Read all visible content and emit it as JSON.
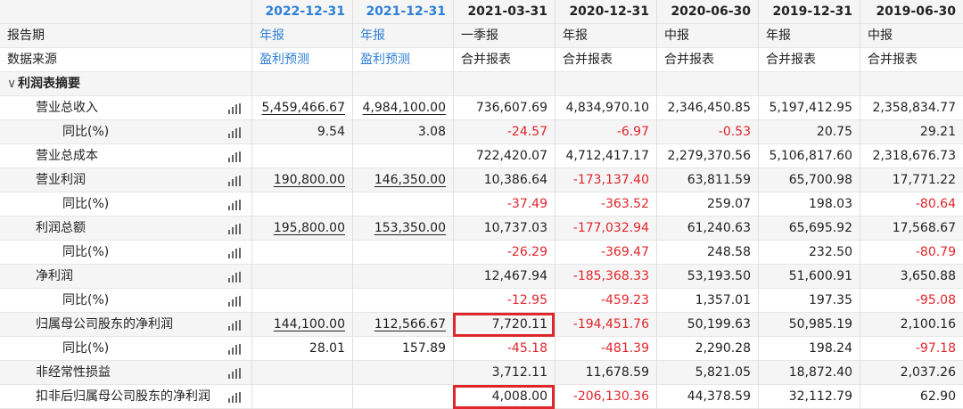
{
  "columns": [
    {
      "date": "2022-12-31",
      "type": "年报",
      "source": "盈利预测",
      "forecast": true
    },
    {
      "date": "2021-12-31",
      "type": "年报",
      "source": "盈利预测",
      "forecast": true
    },
    {
      "date": "2021-03-31",
      "type": "一季报",
      "source": "合并报表",
      "forecast": false
    },
    {
      "date": "2020-12-31",
      "type": "年报",
      "source": "合并报表",
      "forecast": false
    },
    {
      "date": "2020-06-30",
      "type": "中报",
      "source": "合并报表",
      "forecast": false
    },
    {
      "date": "2019-12-31",
      "type": "年报",
      "source": "合并报表",
      "forecast": false
    },
    {
      "date": "2019-06-30",
      "type": "中报",
      "source": "合并报表",
      "forecast": false
    }
  ],
  "labels": {
    "report_period": "报告期",
    "data_source": "数据来源",
    "section": "利润表摘要",
    "caret": "∨"
  },
  "rows": [
    {
      "label": "营业总收入",
      "level": 1,
      "values": [
        "5,459,466.67",
        "4,984,100.00",
        "736,607.69",
        "4,834,970.10",
        "2,346,450.85",
        "5,197,412.95",
        "2,358,834.77"
      ]
    },
    {
      "label": "同比(%)",
      "level": 2,
      "values": [
        "9.54",
        "3.08",
        "-24.57",
        "-6.97",
        "-0.53",
        "20.75",
        "29.21"
      ]
    },
    {
      "label": "营业总成本",
      "level": 1,
      "values": [
        "",
        "",
        "722,420.07",
        "4,712,417.17",
        "2,279,370.56",
        "5,106,817.60",
        "2,318,676.73"
      ]
    },
    {
      "label": "营业利润",
      "level": 1,
      "values": [
        "190,800.00",
        "146,350.00",
        "10,386.64",
        "-173,137.40",
        "63,811.59",
        "65,700.98",
        "17,771.22"
      ]
    },
    {
      "label": "同比(%)",
      "level": 2,
      "values": [
        "",
        "",
        "-37.49",
        "-363.52",
        "259.07",
        "198.03",
        "-80.64"
      ]
    },
    {
      "label": "利润总额",
      "level": 1,
      "values": [
        "195,800.00",
        "153,350.00",
        "10,737.03",
        "-177,032.94",
        "61,240.63",
        "65,695.92",
        "17,568.67"
      ]
    },
    {
      "label": "同比(%)",
      "level": 2,
      "values": [
        "",
        "",
        "-26.29",
        "-369.47",
        "248.58",
        "232.50",
        "-80.79"
      ]
    },
    {
      "label": "净利润",
      "level": 1,
      "values": [
        "",
        "",
        "12,467.94",
        "-185,368.33",
        "53,193.50",
        "51,600.91",
        "3,650.88"
      ]
    },
    {
      "label": "同比(%)",
      "level": 2,
      "values": [
        "",
        "",
        "-12.95",
        "-459.23",
        "1,357.01",
        "197.35",
        "-95.08"
      ]
    },
    {
      "label": "归属母公司股东的净利润",
      "level": 1,
      "values": [
        "144,100.00",
        "112,566.67",
        "7,720.11",
        "-194,451.76",
        "50,199.63",
        "50,985.19",
        "2,100.16"
      ]
    },
    {
      "label": "同比(%)",
      "level": 2,
      "values": [
        "28.01",
        "157.89",
        "-45.18",
        "-481.39",
        "2,290.28",
        "198.24",
        "-97.18"
      ]
    },
    {
      "label": "非经常性损益",
      "level": 1,
      "values": [
        "",
        "",
        "3,712.11",
        "11,678.59",
        "5,821.05",
        "18,872.40",
        "2,037.26"
      ]
    },
    {
      "label": "扣非后归属母公司股东的净利润",
      "level": 1,
      "values": [
        "",
        "",
        "4,008.00",
        "-206,130.36",
        "44,378.59",
        "32,112.79",
        "62.90"
      ]
    }
  ],
  "highlights": [
    {
      "row": 9,
      "col": 2
    },
    {
      "row": 12,
      "col": 2
    }
  ],
  "underlined_rows": [
    0,
    3,
    5,
    9
  ],
  "colors": {
    "forecast_blue": "#2f7fd6",
    "negative_red": "#e0252b",
    "highlight_red": "#e0252b",
    "header_bg": "#f5f5f5"
  },
  "icon": "bar-chart-icon"
}
